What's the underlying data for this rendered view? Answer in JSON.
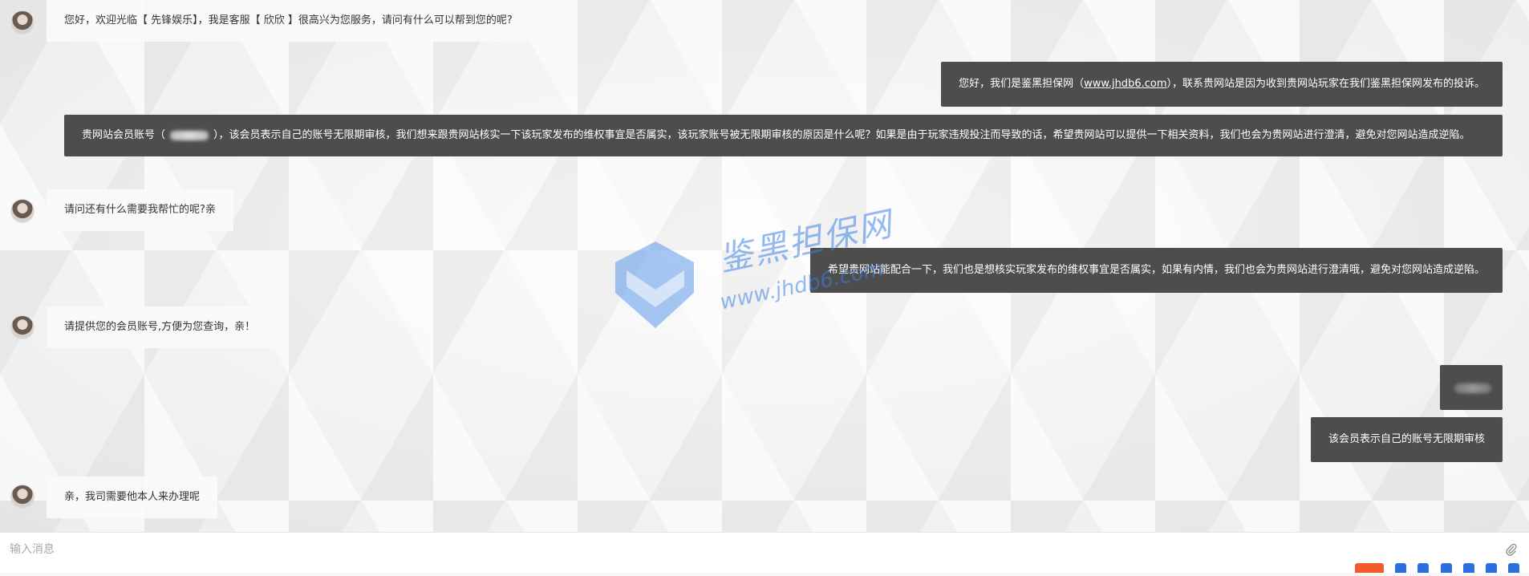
{
  "messages": {
    "m1": {
      "text": "您好，欢迎光临【 先锋娱乐】，我是客服【 欣欣 】很高兴为您服务，请问有什么可以帮到您的呢?"
    },
    "m2": {
      "prefix": "您好，我们是鉴黑担保网（",
      "link": "www.jhdb6.com",
      "suffix": "），联系贵网站是因为收到贵网站玩家在我们鉴黑担保网发布的投诉。"
    },
    "m3": {
      "part1": "贵网站会员账号（",
      "part2": "），该会员表示自己的账号无限期审核，我们想来跟贵网站核实一下该玩家发布的维权事宜是否属实，该玩家账号被无限期审核的原因是什么呢？如果是由于玩家违规投注而导致的话，希望贵网站可以提供一下相关资料，我们也会为贵网站进行澄清，避免对您网站造成逆陷。"
    },
    "m4": {
      "text": "请问还有什么需要我帮忙的呢?亲"
    },
    "m5": {
      "text": "希望贵网站能配合一下，我们也是想核实玩家发布的维权事宜是否属实，如果有内情，我们也会为贵网站进行澄清哦，避免对您网站造成逆陷。"
    },
    "m6": {
      "text": "请提供您的会员账号,方便为您查询，亲！"
    },
    "m8": {
      "text": "该会员表示自己的账号无限期审核"
    },
    "m9": {
      "text": "亲，我司需要他本人来办理呢"
    }
  },
  "watermark": {
    "brand": "鉴黑担保网",
    "url": "www.jhdb6.com"
  },
  "input": {
    "placeholder": "输入消息"
  },
  "icons": {
    "attach": "paperclip-icon"
  },
  "colors": {
    "outgoing_bubble": "#4d4d4d",
    "incoming_bubble": "#fafafa",
    "watermark": "#3c82e6"
  }
}
